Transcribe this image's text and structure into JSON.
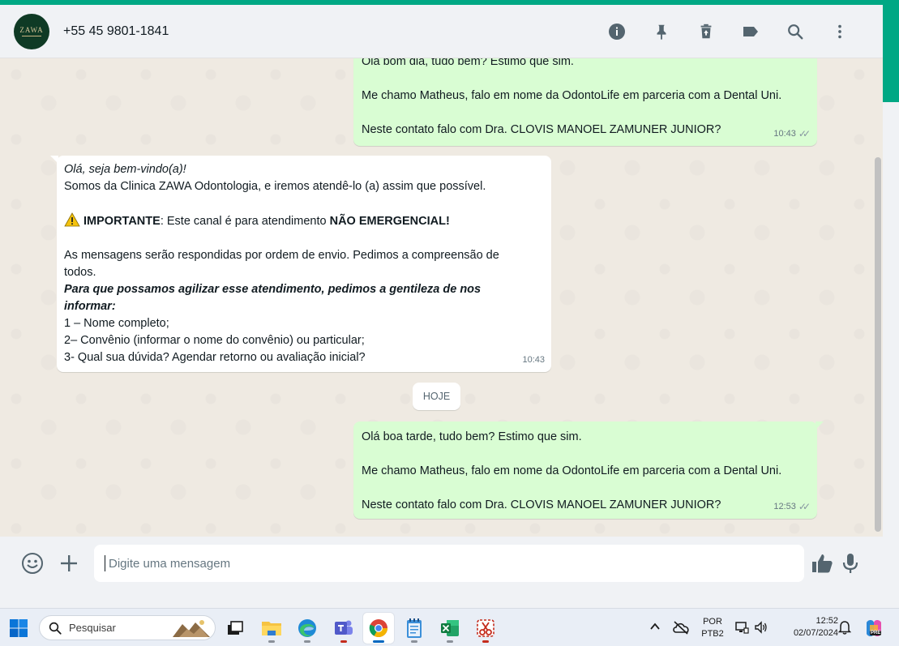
{
  "colors": {
    "accent": "#00a884",
    "outgoing": "#d9fdd3",
    "incoming": "#ffffff",
    "chat_bg": "#efeae2"
  },
  "header": {
    "avatar_text": "ZAWA",
    "contact_name": "+55 45 9801-1841",
    "icons": [
      "info-icon",
      "pin-icon",
      "delete-icon",
      "label-icon",
      "search-icon",
      "menu-icon"
    ]
  },
  "messages": [
    {
      "direction": "out",
      "lines": [
        "Olá bom dia, tudo bem? Estimo que sim.",
        "",
        "Me chamo Matheus, falo em nome da OdontoLife em parceria com a Dental Uni.",
        "",
        "Neste contato falo com Dra. CLOVIS MANOEL ZAMUNER JUNIOR?"
      ],
      "time": "10:43"
    },
    {
      "direction": "in",
      "greeting": "Olá, seja bem-vindo(a)!",
      "intro": "Somos da Clinica ZAWA Odontologia, e iremos  atendê-lo (a) assim que possível.",
      "important_label": "IMPORTANTE",
      "important_text": ": Este canal é para atendimento ",
      "important_emph": "NÃO EMERGENCIAL!",
      "order_line1": "As mensagens serão respondidas por ordem de envio. Pedimos a compreensão de",
      "order_line2": "todos.",
      "request_line1": "Para que possamos agilizar esse atendimento, pedimos a gentileza de nos",
      "request_line2": "informar:",
      "items": [
        "1 – Nome completo;",
        "2– Convênio (informar o nome do convênio) ou particular;",
        "3- Qual sua dúvida? Agendar retorno ou avaliação inicial?"
      ],
      "time": "10:43"
    },
    {
      "direction": "out",
      "lines": [
        "Olá boa tarde, tudo bem? Estimo que sim.",
        "",
        "Me chamo Matheus, falo em nome da OdontoLife em parceria com a Dental Uni.",
        "",
        "Neste contato falo com Dra. CLOVIS MANOEL ZAMUNER JUNIOR?"
      ],
      "time": "12:53"
    }
  ],
  "day_separator": "HOJE",
  "composer": {
    "placeholder": "Digite uma mensagem"
  },
  "taskbar": {
    "search_label": "Pesquisar",
    "language_line1": "POR",
    "language_line2": "PTB2",
    "time": "12:52",
    "date": "02/07/2024",
    "copilot_badge": "PRE"
  }
}
